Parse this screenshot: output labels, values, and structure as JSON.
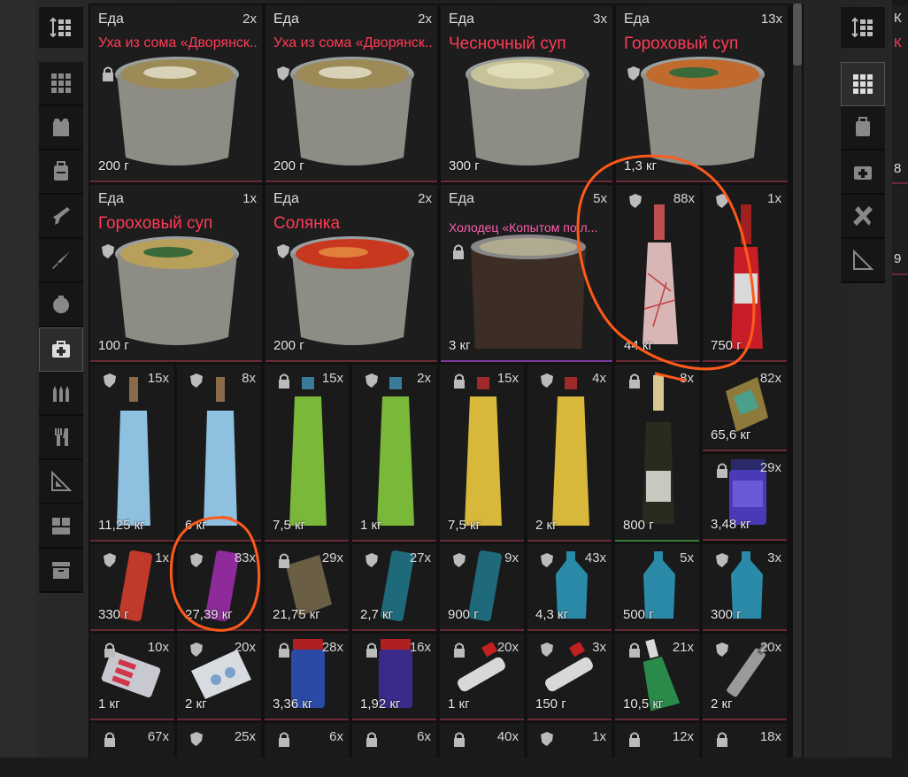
{
  "left_sidebar": {
    "items": [
      {
        "icon": "grid-icon"
      },
      {
        "icon": "backpack-icon"
      },
      {
        "icon": "rig-icon"
      },
      {
        "icon": "weapon-icon"
      },
      {
        "icon": "knife-icon"
      },
      {
        "icon": "grenade-icon"
      },
      {
        "icon": "medkit-icon",
        "active": true
      },
      {
        "icon": "ammo-icon"
      },
      {
        "icon": "food-icon"
      },
      {
        "icon": "ruler-icon"
      },
      {
        "icon": "container-icon"
      },
      {
        "icon": "case-icon"
      }
    ]
  },
  "tiles": [
    {
      "category": "Еда",
      "count": "2x",
      "name": "Уха из сома «Дворянск...",
      "weight": "200 г"
    },
    {
      "category": "Еда",
      "count": "2x",
      "name": "Уха из сома «Дворянск...",
      "weight": "200 г"
    },
    {
      "category": "Еда",
      "count": "3x",
      "name": "Чесночный суп",
      "weight": "300 г"
    },
    {
      "category": "Еда",
      "count": "13x",
      "name": "Гороховый суп",
      "weight": "1,3 кг"
    },
    {
      "category": "Еда",
      "count": "1x",
      "name": "Гороховый суп",
      "weight": "100 г"
    },
    {
      "category": "Еда",
      "count": "2x",
      "name": "Солянка",
      "weight": "200 г"
    },
    {
      "category": "Еда",
      "count": "5x",
      "name": "Холодец «Копытом по л...",
      "weight": "3 кг"
    },
    {
      "count": "88x",
      "weight": "44 кг"
    },
    {
      "count": "1x",
      "weight": "750 г"
    },
    {
      "count": "15x",
      "weight": "11,25 кг"
    },
    {
      "count": "8x",
      "weight": "6 кг"
    },
    {
      "count": "15x",
      "weight": "7,5 кг"
    },
    {
      "count": "2x",
      "weight": "1 кг"
    },
    {
      "count": "15x",
      "weight": "7,5 кг"
    },
    {
      "count": "4x",
      "weight": "2 кг"
    },
    {
      "count": "8x",
      "weight": "800 г"
    },
    {
      "count": "82x",
      "weight": "65,6 кг"
    },
    {
      "count": "29x",
      "weight": "3,48 кг"
    },
    {
      "count": "1x",
      "weight": "330 г"
    },
    {
      "count": "83x",
      "weight": "27,39 кг"
    },
    {
      "count": "29x",
      "weight": "21,75 кг"
    },
    {
      "count": "27x",
      "weight": "2,7 кг"
    },
    {
      "count": "9x",
      "weight": "900 г"
    },
    {
      "count": "43x",
      "weight": "4,3 кг"
    },
    {
      "count": "5x",
      "weight": "500 г"
    },
    {
      "count": "3x",
      "weight": "300 г"
    },
    {
      "count": "10x",
      "weight": "1 кг"
    },
    {
      "count": "20x",
      "weight": "2 кг"
    },
    {
      "count": "28x",
      "weight": "3,36 кг"
    },
    {
      "count": "16x",
      "weight": "1,92 кг"
    },
    {
      "count": "20x",
      "weight": "1 кг"
    },
    {
      "count": "3x",
      "weight": "150 г"
    },
    {
      "count": "21x",
      "weight": "10,5 кг"
    },
    {
      "count": "20x",
      "weight": "2 кг"
    },
    {
      "count": "67x"
    },
    {
      "count": "25x"
    },
    {
      "count": "6x"
    },
    {
      "count": "6x"
    },
    {
      "count": "40x"
    },
    {
      "count": "1x"
    },
    {
      "count": "12x"
    },
    {
      "count": "18x"
    }
  ],
  "right_panel": {
    "partial_text": [
      "К",
      "К",
      "8",
      "9"
    ]
  },
  "colors": {
    "item_name_red": "#ff3b55",
    "item_name_pink": "#ff5fb0",
    "annotation_orange": "#ff5a1a"
  }
}
